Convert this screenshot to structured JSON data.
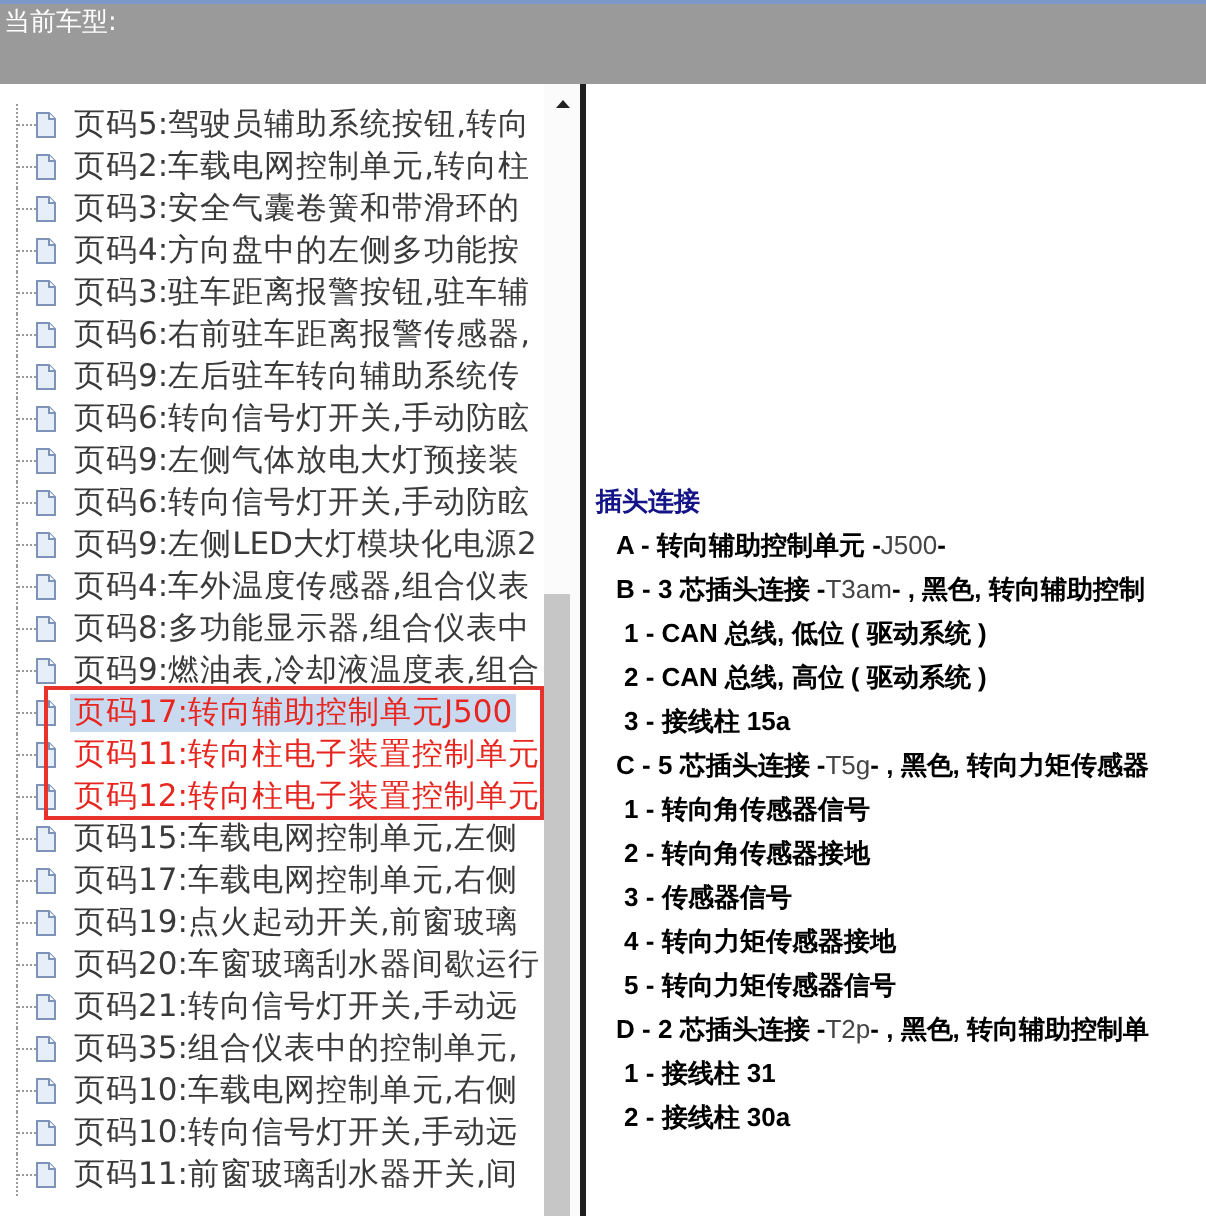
{
  "header": {
    "label": "当前车型:"
  },
  "page_list": {
    "items": [
      {
        "label": "页码5:驾驶员辅助系统按钮,转向",
        "selected": false,
        "highlighted": false
      },
      {
        "label": "页码2:车载电网控制单元,转向柱",
        "selected": false,
        "highlighted": false
      },
      {
        "label": "页码3:安全气囊卷簧和带滑环的",
        "selected": false,
        "highlighted": false
      },
      {
        "label": "页码4:方向盘中的左侧多功能按",
        "selected": false,
        "highlighted": false
      },
      {
        "label": "页码3:驻车距离报警按钮,驻车辅",
        "selected": false,
        "highlighted": false
      },
      {
        "label": "页码6:右前驻车距离报警传感器,",
        "selected": false,
        "highlighted": false
      },
      {
        "label": "页码9:左后驻车转向辅助系统传",
        "selected": false,
        "highlighted": false
      },
      {
        "label": "页码6:转向信号灯开关,手动防眩",
        "selected": false,
        "highlighted": false
      },
      {
        "label": "页码9:左侧气体放电大灯预接装",
        "selected": false,
        "highlighted": false
      },
      {
        "label": "页码6:转向信号灯开关,手动防眩",
        "selected": false,
        "highlighted": false
      },
      {
        "label": "页码9:左侧LED大灯模块化电源2",
        "selected": false,
        "highlighted": false
      },
      {
        "label": "页码4:车外温度传感器,组合仪表",
        "selected": false,
        "highlighted": false
      },
      {
        "label": "页码8:多功能显示器,组合仪表中",
        "selected": false,
        "highlighted": false
      },
      {
        "label": "页码9:燃油表,冷却液温度表,组合",
        "selected": false,
        "highlighted": false
      },
      {
        "label": "页码17:转向辅助控制单元J500",
        "selected": true,
        "highlighted": true
      },
      {
        "label": "页码11:转向柱电子装置控制单元",
        "selected": false,
        "highlighted": true
      },
      {
        "label": "页码12:转向柱电子装置控制单元",
        "selected": false,
        "highlighted": true
      },
      {
        "label": "页码15:车载电网控制单元,左侧",
        "selected": false,
        "highlighted": false
      },
      {
        "label": "页码17:车载电网控制单元,右侧",
        "selected": false,
        "highlighted": false
      },
      {
        "label": "页码19:点火起动开关,前窗玻璃",
        "selected": false,
        "highlighted": false
      },
      {
        "label": "页码20:车窗玻璃刮水器间歇运行",
        "selected": false,
        "highlighted": false
      },
      {
        "label": "页码21:转向信号灯开关,手动远",
        "selected": false,
        "highlighted": false
      },
      {
        "label": "页码35:组合仪表中的控制单元,",
        "selected": false,
        "highlighted": false
      },
      {
        "label": "页码10:车载电网控制单元,右侧",
        "selected": false,
        "highlighted": false
      },
      {
        "label": "页码10:转向信号灯开关,手动远",
        "selected": false,
        "highlighted": false
      },
      {
        "label": "页码11:前窗玻璃刮水器开关,间",
        "selected": false,
        "highlighted": false
      }
    ]
  },
  "connector_panel": {
    "title": "插头连接",
    "lines": [
      {
        "kind": "connector",
        "text": "**A - 转向辅助控制单元 -**J500**-**"
      },
      {
        "kind": "connector",
        "text": "**B - 3 芯插头连接 -**T3am**- , 黑色, 转向辅助控制**"
      },
      {
        "kind": "pin",
        "text": "1 - CAN 总线, 低位 ( 驱动系统 )"
      },
      {
        "kind": "pin",
        "text": "2 - CAN 总线, 高位 ( 驱动系统 )"
      },
      {
        "kind": "pin",
        "text": "3 - 接线柱 15a"
      },
      {
        "kind": "connector",
        "text": "**C - 5 芯插头连接 -**T5g**- , 黑色, 转向力矩传感器**"
      },
      {
        "kind": "pin",
        "text": "1 - 转向角传感器信号"
      },
      {
        "kind": "pin",
        "text": "2 - 转向角传感器接地"
      },
      {
        "kind": "pin",
        "text": "3 - 传感器信号"
      },
      {
        "kind": "pin",
        "text": "4 - 转向力矩传感器接地"
      },
      {
        "kind": "pin",
        "text": "5 - 转向力矩传感器信号"
      },
      {
        "kind": "connector",
        "text": "**D - 2 芯插头连接 -**T2p**- , 黑色, 转向辅助控制单**"
      },
      {
        "kind": "pin",
        "text": "1 - 接线柱 31"
      },
      {
        "kind": "pin",
        "text": "2 - 接线柱 30a"
      }
    ]
  }
}
